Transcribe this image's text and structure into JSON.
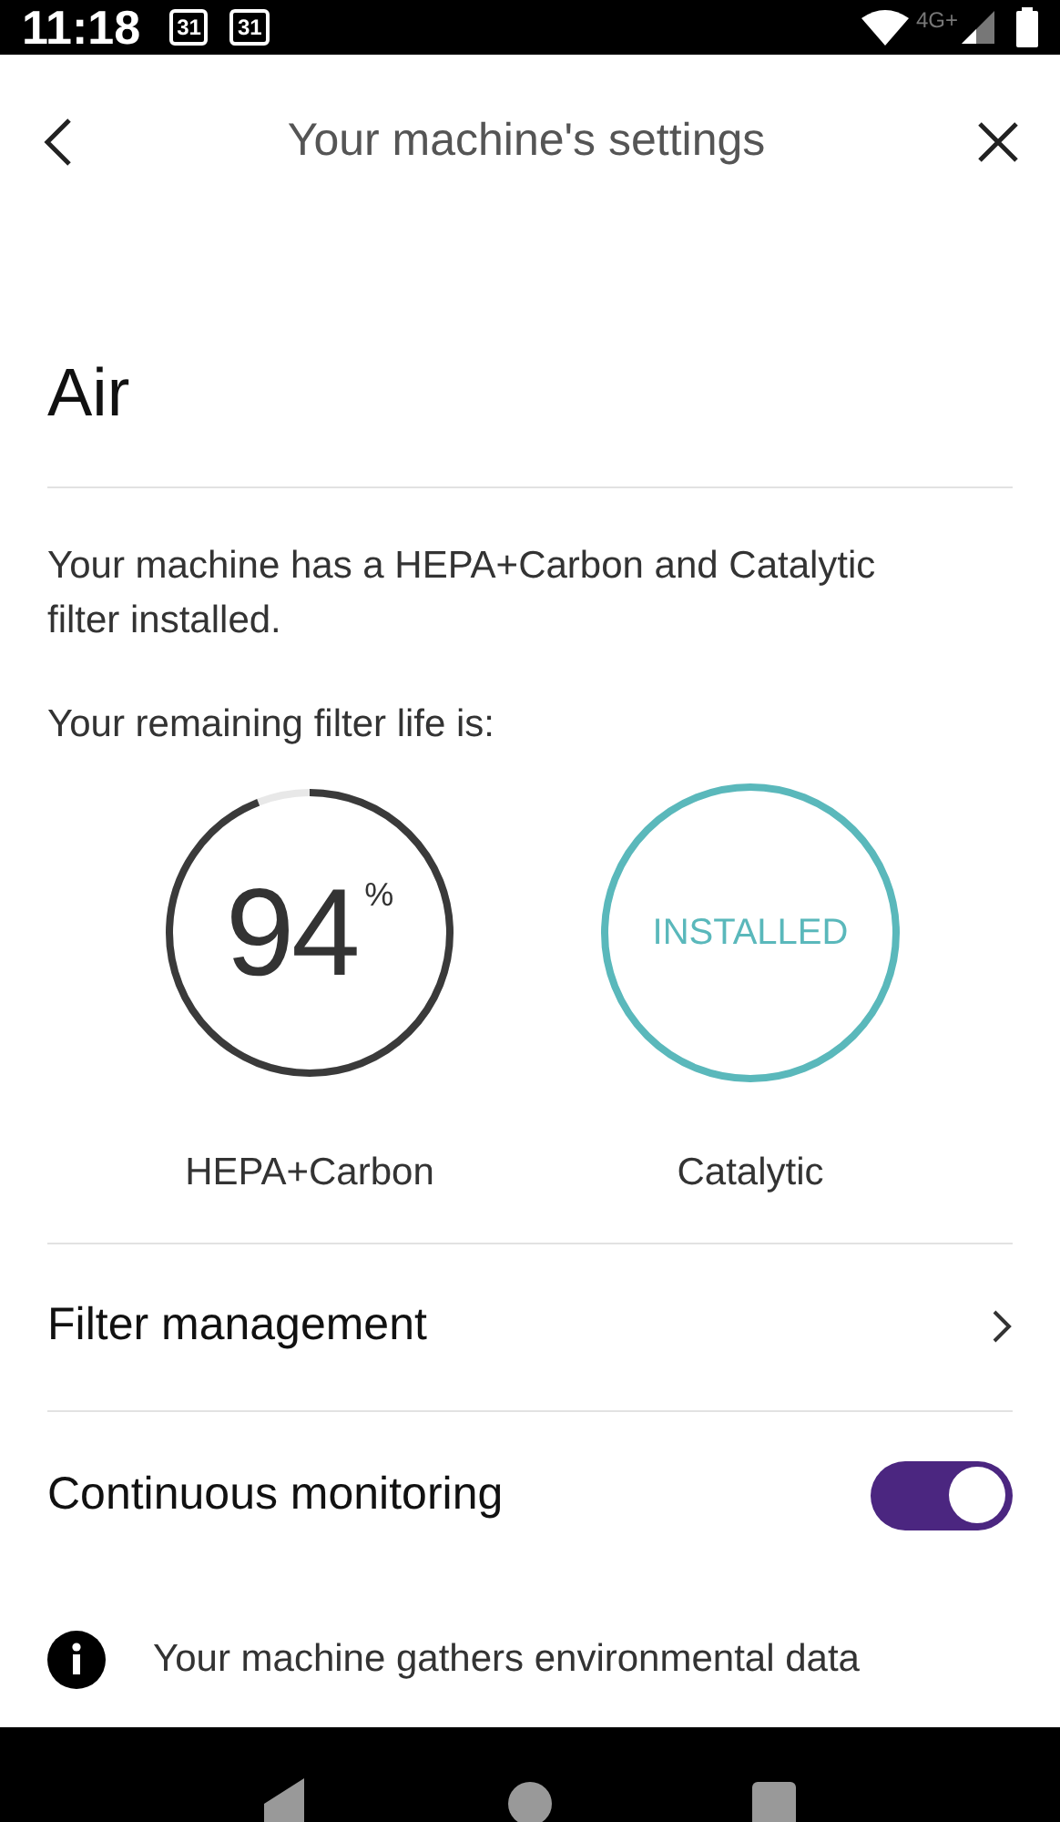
{
  "status_bar": {
    "time": "11:18",
    "calendar_badges": [
      "31",
      "31"
    ],
    "network": "4G+"
  },
  "header": {
    "title": "Your machine's settings"
  },
  "section": {
    "title": "Air"
  },
  "description": "Your machine has a HEPA+Carbon and Catalytic filter installed.",
  "filter_life_label": "Your remaining filter life is:",
  "filters": [
    {
      "kind": "gauge",
      "value": "94",
      "unit": "%",
      "level": 0.94,
      "name": "HEPA+Carbon"
    },
    {
      "kind": "status",
      "status": "INSTALLED",
      "name": "Catalytic"
    }
  ],
  "rows": [
    {
      "kind": "link",
      "label": "Filter management"
    },
    {
      "kind": "toggle",
      "label": "Continuous monitoring",
      "on": true
    }
  ],
  "info": "Your machine gathers environmental data"
}
